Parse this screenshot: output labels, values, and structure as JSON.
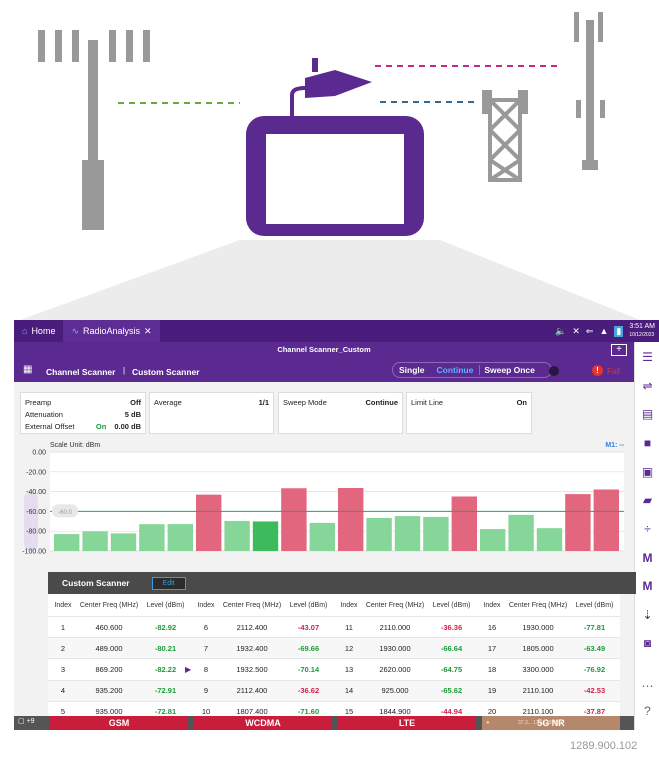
{
  "tabs": [
    {
      "label": "Home"
    },
    {
      "label": "RadioAnalysis"
    }
  ],
  "clock": {
    "time": "3:51 AM",
    "date": "10/12/2023"
  },
  "header": {
    "title": "Channel Scanner_Custom",
    "breadcrumb1": "Channel Scanner",
    "breadcrumb2": "Custom Scanner",
    "mode_single": "Single",
    "mode_continue": "Continue",
    "sweep_once": "Sweep Once",
    "fail": "Fail"
  },
  "params": {
    "preamp_label": "Preamp",
    "preamp_val": "Off",
    "atten_label": "Attenuation",
    "atten_val": "5 dB",
    "ext_label": "External Offset",
    "ext_on": "On",
    "ext_val": "0.00 dB",
    "avg_label": "Average",
    "avg_val": "1/1",
    "sweep_label": "Sweep Mode",
    "sweep_val": "Continue",
    "limit_label": "Limit Line",
    "limit_val": "On"
  },
  "chart_data": {
    "type": "bar",
    "title": "Scale Unit: dBm",
    "marker": "M1: --",
    "limit_label": "-60.0",
    "ylim": [
      -100,
      0
    ],
    "yticks": [
      "0.00",
      "-20.00",
      "-40.00",
      "-60.00",
      "-80.00",
      "-100.00"
    ],
    "limit": -60,
    "values": [
      -82.92,
      -80.21,
      -82.22,
      -72.91,
      -72.81,
      -43.07,
      -69.66,
      -70.14,
      -36.62,
      -71.6,
      -36.36,
      -66.64,
      -64.75,
      -65.62,
      -44.94,
      -77.81,
      -63.49,
      -76.92,
      -42.53,
      -37.87
    ],
    "status": [
      "pass",
      "pass",
      "pass",
      "pass",
      "pass",
      "fail",
      "pass",
      "selected",
      "fail",
      "pass",
      "fail",
      "pass",
      "pass",
      "pass",
      "fail",
      "pass",
      "pass",
      "pass",
      "fail",
      "fail"
    ]
  },
  "table": {
    "title": "Custom Scanner",
    "edit": "Edit",
    "h_index": "Index",
    "h_freq": "Center Freq (MHz)",
    "h_level": "Level (dBm)",
    "groups": [
      [
        [
          "1",
          "460.600",
          "-82.92",
          "g"
        ],
        [
          "2",
          "489.000",
          "-80.21",
          "g"
        ],
        [
          "3",
          "869.200",
          "-82.22",
          "g"
        ],
        [
          "4",
          "935.200",
          "-72.91",
          "g"
        ],
        [
          "5",
          "935.000",
          "-72.81",
          "g"
        ]
      ],
      [
        [
          "6",
          "2112.400",
          "-43.07",
          "r"
        ],
        [
          "7",
          "1932.400",
          "-69.66",
          "g"
        ],
        [
          "8",
          "1932.500",
          "-70.14",
          "g"
        ],
        [
          "9",
          "2112.400",
          "-36.62",
          "r"
        ],
        [
          "10",
          "1807.400",
          "-71.60",
          "g"
        ]
      ],
      [
        [
          "11",
          "2110.000",
          "-36.36",
          "r"
        ],
        [
          "12",
          "1930.000",
          "-66.64",
          "g"
        ],
        [
          "13",
          "2620.000",
          "-64.75",
          "g"
        ],
        [
          "14",
          "925.000",
          "-65.62",
          "g"
        ],
        [
          "15",
          "1844.900",
          "-44.94",
          "r"
        ]
      ],
      [
        [
          "16",
          "1930.000",
          "-77.81",
          "g"
        ],
        [
          "17",
          "1805.000",
          "-63.49",
          "g"
        ],
        [
          "18",
          "3300.000",
          "-76.92",
          "g"
        ],
        [
          "19",
          "2110.100",
          "-42.53",
          "r"
        ],
        [
          "20",
          "2110.100",
          "-37.87",
          "r"
        ]
      ]
    ]
  },
  "bottom": {
    "notif": "+9",
    "gsm": "GSM",
    "wcdma": "WCDMA",
    "lte": "LTE",
    "nr": "5G NR",
    "coords": "37.3... 127.1255833"
  },
  "footer_code": "1289.900.102"
}
